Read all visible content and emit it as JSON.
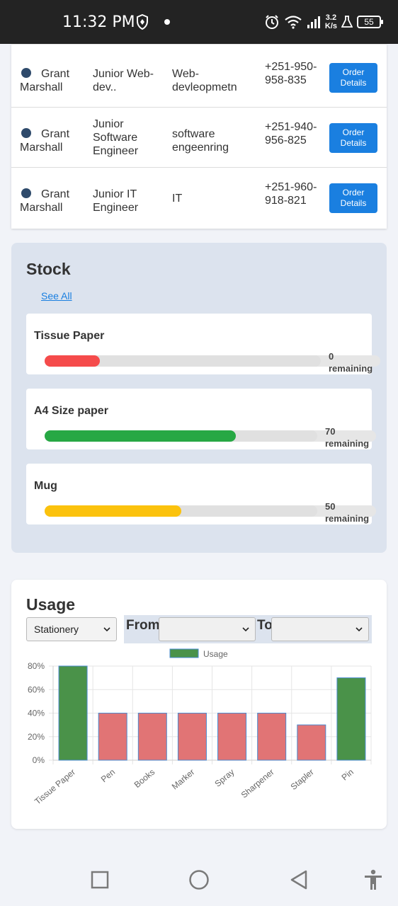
{
  "status_bar": {
    "time": "11:32 PM",
    "speed_value": "3.2",
    "speed_unit": "K/s",
    "battery": "55"
  },
  "employees": [
    {
      "first": "Grant",
      "last": "Marshall",
      "title": "Junior Web-dev..",
      "department": "Web-devleopmetn",
      "phone": "+251-950-958-835",
      "action": "Order Details"
    },
    {
      "first": "Grant",
      "last": "Marshall",
      "title": "Junior Software Engineer",
      "department": "software engeenring",
      "phone": "+251-940-956-825",
      "action": "Order Details"
    },
    {
      "first": "Grant",
      "last": "Marshall",
      "title": "Junior IT Engineer",
      "department": "IT",
      "phone": "+251-960-918-821",
      "action": "Order Details"
    }
  ],
  "stock": {
    "title": "Stock",
    "see_all": "See All",
    "items": [
      {
        "name": "Tissue Paper",
        "remaining_value": "0",
        "remaining_word": "remaining",
        "fill_fraction": 0.2,
        "color": "#f54b4b"
      },
      {
        "name": "A4 Size paper",
        "remaining_value": "70",
        "remaining_word": "remaining",
        "fill_fraction": 0.7,
        "color": "#27a844"
      },
      {
        "name": "Mug",
        "remaining_value": "50",
        "remaining_word": "remaining",
        "fill_fraction": 0.5,
        "color": "#fbc20d"
      }
    ]
  },
  "usage": {
    "title": "Usage",
    "category_select": "Stationery",
    "from_label": "From",
    "to_label": "To",
    "from_value": "",
    "to_value": ""
  },
  "chart_data": {
    "type": "bar",
    "legend": "Usage",
    "legend_position": "top",
    "categories": [
      "Tissue Paper",
      "Pen",
      "Books",
      "Marker",
      "Spray",
      "Sharpener",
      "Stapler",
      "Pin"
    ],
    "values": [
      80,
      40,
      40,
      40,
      40,
      40,
      30,
      70
    ],
    "bar_colors": [
      "#4a9249",
      "#e17475",
      "#e17475",
      "#e17475",
      "#e17475",
      "#e17475",
      "#e17475",
      "#4a9249"
    ],
    "y_ticks": [
      "0%",
      "20%",
      "40%",
      "60%",
      "80%"
    ],
    "ylim": [
      0,
      80
    ],
    "grid": true
  }
}
